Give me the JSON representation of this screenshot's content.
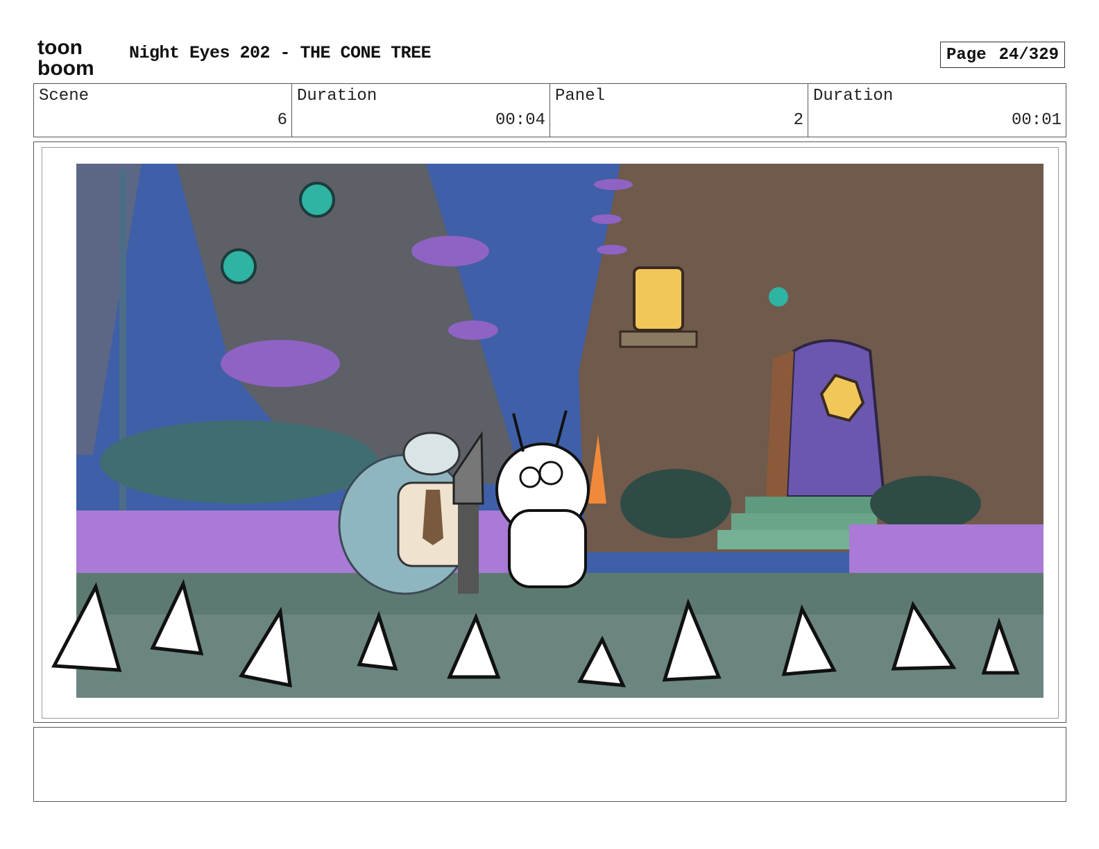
{
  "header": {
    "logo_top": "toon",
    "logo_bottom": "boom",
    "title": "Night Eyes 202 - THE CONE TREE",
    "page_label": "Page",
    "page_value": "24/329"
  },
  "info": {
    "scene_label": "Scene",
    "scene_value": "6",
    "duration_label": "Duration",
    "duration_value": "00:04",
    "panel_label": "Panel",
    "panel_value": "2",
    "panel_duration_label": "Duration",
    "panel_duration_value": "00:01"
  },
  "colors": {
    "sky": "#3f5fa8",
    "tree_left": "#5d6067",
    "tree_right": "#6f5a4c",
    "fence": "#a97ad6",
    "ground": "#5d7a72",
    "road": "#6b8680",
    "door": "#6b57b0",
    "window": "#f2c75a",
    "teal": "#2fb3a3",
    "mushroom": "#8e63c4"
  }
}
